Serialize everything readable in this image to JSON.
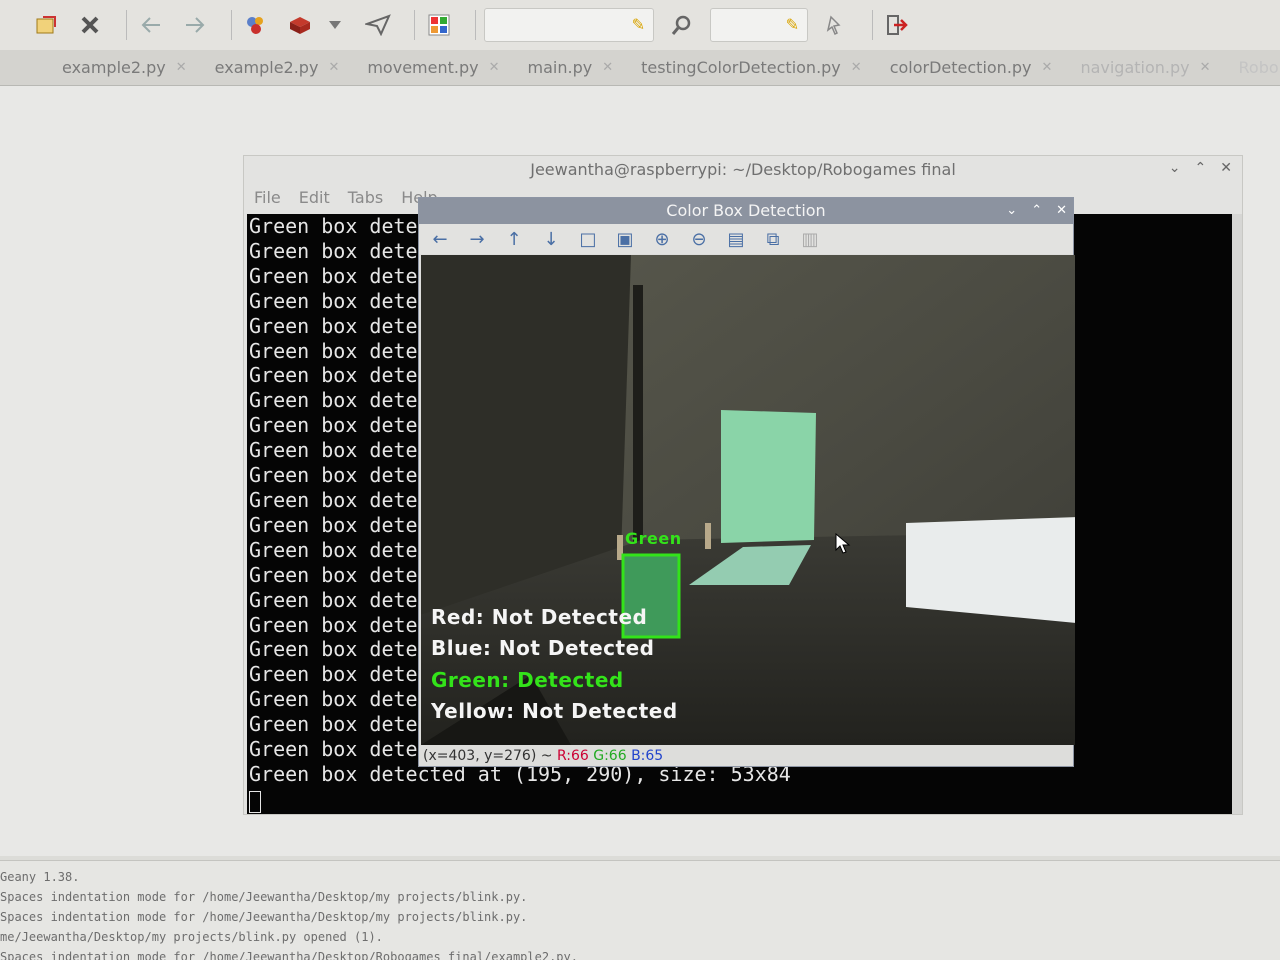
{
  "toolbar": {
    "icons": [
      "open-file-icon",
      "close-icon",
      "back-icon",
      "forward-icon",
      "build-icon",
      "execute-icon",
      "dropdown-icon",
      "send-icon",
      "color-picker-icon",
      "search-icon",
      "jump-icon",
      "quit-icon"
    ]
  },
  "tabs": [
    {
      "label": "example2.py"
    },
    {
      "label": "example2.py"
    },
    {
      "label": "movement.py"
    },
    {
      "label": "main.py"
    },
    {
      "label": "testingColorDetection.py"
    },
    {
      "label": "colorDetection.py"
    },
    {
      "label": "navigation.py"
    },
    {
      "label": "Robo"
    }
  ],
  "terminal": {
    "title": "Jeewantha@raspberrypi: ~/Desktop/Robogames final",
    "menu": [
      "File",
      "Edit",
      "Tabs",
      "Help"
    ],
    "line_text": "Green box dete",
    "last_line": "Green box detected at (195, 290), size: 53x84"
  },
  "viewer": {
    "title": "Color Box Detection",
    "box_label": "Green",
    "overlay": {
      "red": "Red: Not Detected",
      "blue": "Blue: Not Detected",
      "green": "Green: Detected",
      "yellow": "Yellow: Not Detected"
    },
    "status_coords": "(x=403, y=276) ~",
    "status_r": "R:66",
    "status_g": "G:66",
    "status_b": "B:65"
  },
  "messages": [
    "Geany 1.38.",
    "Spaces indentation mode for /home/Jeewantha/Desktop/my projects/blink.py.",
    "Spaces indentation mode for /home/Jeewantha/Desktop/my projects/blink.py.",
    "me/Jeewantha/Desktop/my projects/blink.py opened (1).",
    "Spaces indentation mode for /home/Jeewantha/Desktop/Robogames_final/example2.py."
  ],
  "colors": {
    "detect_green": "#33e31a",
    "overlay_white": "#f5f5f5"
  }
}
